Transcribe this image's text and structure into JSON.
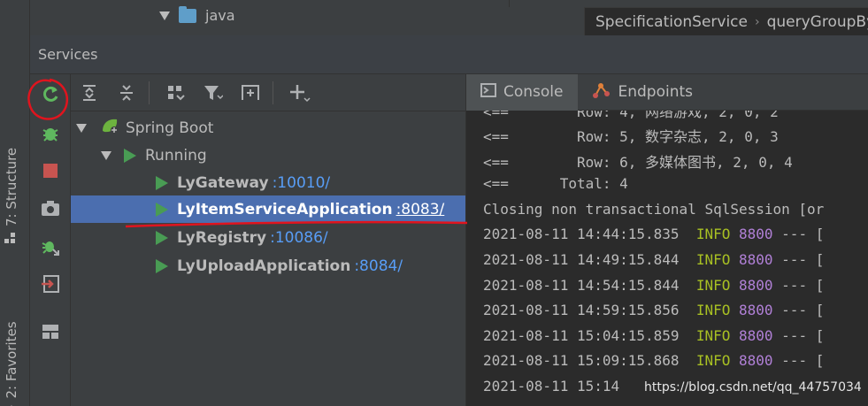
{
  "project_tree": {
    "folder_label": "java"
  },
  "editor": {
    "breadcrumb": [
      "SpecificationService",
      "queryGroupBy"
    ]
  },
  "left_stripe": {
    "tabs": [
      {
        "label": "7: Structure",
        "icon": "structure-icon"
      },
      {
        "label": "2: Favorites",
        "icon": "star-icon"
      }
    ]
  },
  "services": {
    "title": "Services",
    "actions": [
      "rerun-icon",
      "debug-icon",
      "stop-icon",
      "camera-icon",
      "debug-attach-icon",
      "login-icon",
      "layout-icon"
    ],
    "toolbar": [
      "expand-all-icon",
      "collapse-all-icon",
      "group-icon",
      "filter-icon",
      "add-service-icon",
      "add-icon"
    ],
    "tree": {
      "root": "Spring Boot",
      "group": "Running",
      "items": [
        {
          "name": "LyGateway",
          "port": ":10010/"
        },
        {
          "name": "LyItemServiceApplication",
          "port": ":8083/"
        },
        {
          "name": "LyRegistry",
          "port": ":10086/"
        },
        {
          "name": "LyUploadApplication",
          "port": ":8084/"
        }
      ],
      "selected_index": 1
    }
  },
  "console": {
    "tabs": [
      {
        "label": "Console",
        "icon": "console-icon",
        "active": true
      },
      {
        "label": "Endpoints",
        "icon": "endpoints-icon",
        "active": false
      }
    ],
    "lines": [
      {
        "text": "<==        Row: 4, 网络游戏, 2, 0, 2"
      },
      {
        "text": "<==        Row: 5, 数字杂志, 2, 0, 3"
      },
      {
        "text": "<==        Row: 6, 多媒体图书, 2, 0, 4"
      },
      {
        "text": "<==      Total: 4"
      },
      {
        "text": "Closing non transactional SqlSession [or"
      },
      {
        "time": "2021-08-11 14:44:15.835",
        "level": "INFO",
        "pid": "8800",
        "rest": "--- ["
      },
      {
        "time": "2021-08-11 14:49:15.844",
        "level": "INFO",
        "pid": "8800",
        "rest": "--- ["
      },
      {
        "time": "2021-08-11 14:54:15.844",
        "level": "INFO",
        "pid": "8800",
        "rest": "--- ["
      },
      {
        "time": "2021-08-11 14:59:15.856",
        "level": "INFO",
        "pid": "8800",
        "rest": "--- ["
      },
      {
        "time": "2021-08-11 15:04:15.859",
        "level": "INFO",
        "pid": "8800",
        "rest": "--- ["
      },
      {
        "time": "2021-08-11 15:09:15.868",
        "level": "INFO",
        "pid": "8800",
        "rest": "--- ["
      },
      {
        "time": "2021-08-11 15:14",
        "level": "",
        "pid": "",
        "rest": ""
      }
    ]
  },
  "watermark": "https://blog.csdn.net/qq_44757034",
  "colors": {
    "annotation": "#e0141e",
    "selection": "#4b6eaf",
    "run_green": "#499c54",
    "link_blue": "#589df6",
    "info_green": "#a8c023"
  }
}
